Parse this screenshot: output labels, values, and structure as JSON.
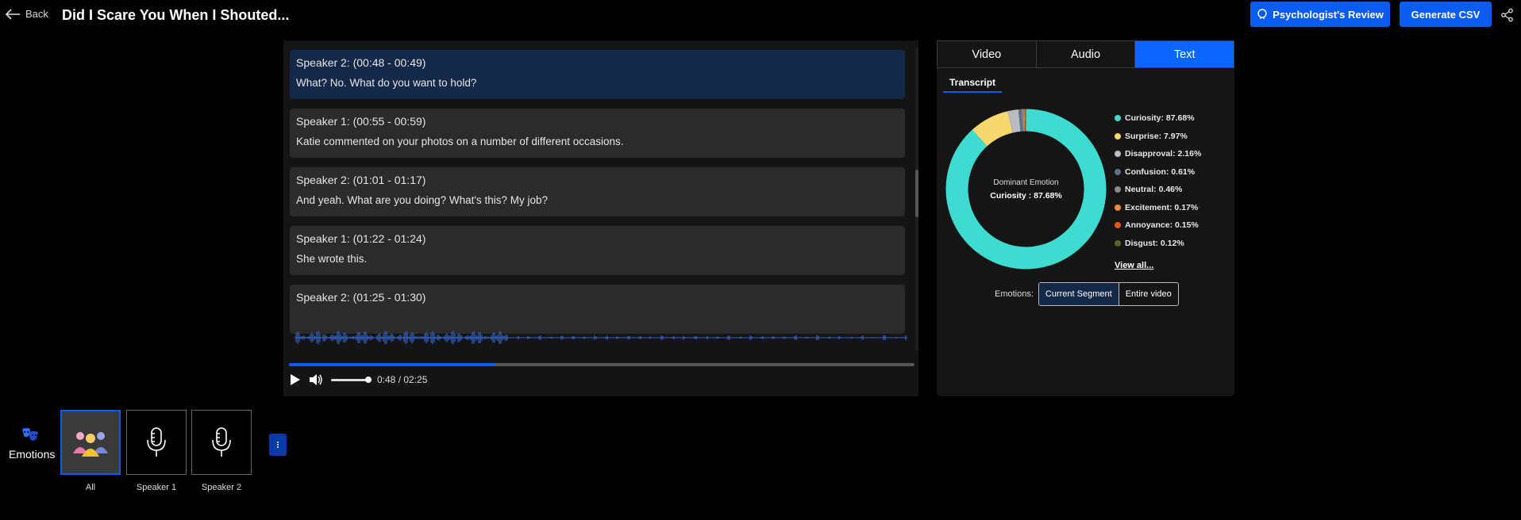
{
  "header": {
    "back_label": "Back",
    "title": "Did I Scare You When I Shouted...",
    "psych_review_label": "Psychologist's Review",
    "generate_csv_label": "Generate CSV"
  },
  "transcript": {
    "segments": [
      {
        "speaker": "Speaker 2: (00:48 - 00:49)",
        "text": "What? No. What do you want to hold?"
      },
      {
        "speaker": "Speaker 1: (00:55 - 00:59)",
        "text": "Katie commented on your photos on a number of different occasions."
      },
      {
        "speaker": "Speaker 2: (01:01 - 01:17)",
        "text": "And yeah. What are you doing? What's this? My job?"
      },
      {
        "speaker": "Speaker 1: (01:22 - 01:24)",
        "text": "She wrote this."
      },
      {
        "speaker": "Speaker 2: (01:25 - 01:30)",
        "text": ""
      }
    ]
  },
  "player": {
    "time": "0:48 / 02:25",
    "progress": 0.33,
    "volume": 1.0
  },
  "panel": {
    "tabs": [
      "Video",
      "Audio",
      "Text"
    ],
    "active_tab": "Text",
    "subtab": "Transcript",
    "dominant_label": "Dominant Emotion",
    "dominant_value": "Curiosity : 87.68%",
    "view_all": "View all...",
    "emotions_label": "Emotions:",
    "toggle": [
      "Current Segment",
      "Entire video"
    ]
  },
  "chart_data": {
    "type": "pie",
    "categories": [
      "Curiosity",
      "Surprise",
      "Disapproval",
      "Confusion",
      "Neutral",
      "Excitement",
      "Annoyance",
      "Disgust"
    ],
    "values": [
      87.68,
      7.97,
      2.16,
      0.61,
      0.46,
      0.17,
      0.15,
      0.12
    ],
    "labels": [
      "Curiosity: 87.68%",
      "Surprise: 7.97%",
      "Disapproval: 2.16%",
      "Confusion: 0.61%",
      "Neutral: 0.46%",
      "Excitement: 0.17%",
      "Annoyance: 0.15%",
      "Disgust: 0.12%"
    ],
    "colors": [
      "#3ddbd0",
      "#f6d86e",
      "#b9bcc2",
      "#5e7087",
      "#8a8a8a",
      "#f08a3a",
      "#e4561e",
      "#4f6a2a"
    ]
  },
  "bottom": {
    "emotions_label": "Emotions",
    "speakers": [
      "All",
      "Speaker 1",
      "Speaker 2"
    ]
  }
}
